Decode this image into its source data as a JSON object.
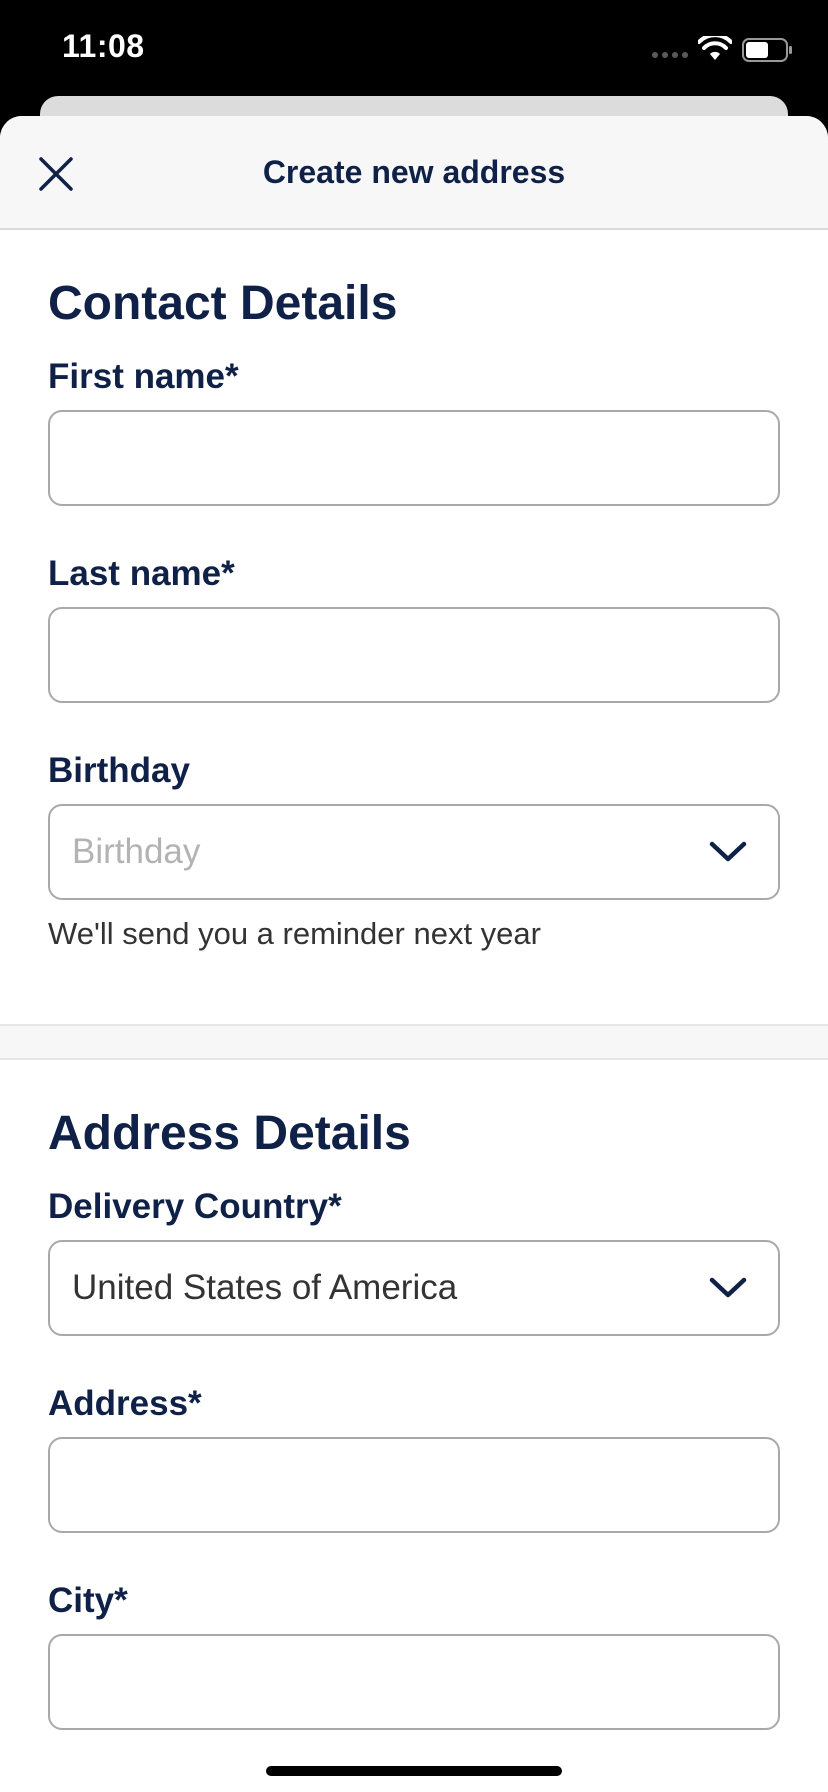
{
  "status_bar": {
    "time": "11:08",
    "icons": [
      "signal-icon",
      "wifi-icon",
      "battery-icon"
    ]
  },
  "header": {
    "title": "Create new address",
    "close_icon": "close-icon"
  },
  "contact_section": {
    "heading": "Contact Details",
    "first_name": {
      "label": "First name*",
      "value": ""
    },
    "last_name": {
      "label": "Last name*",
      "value": ""
    },
    "birthday": {
      "label": "Birthday",
      "placeholder": "Birthday",
      "helper": "We'll send you a reminder next year"
    }
  },
  "address_section": {
    "heading": "Address Details",
    "delivery_country": {
      "label": "Delivery Country*",
      "value": "United States of America"
    },
    "address": {
      "label": "Address*",
      "value": ""
    },
    "city": {
      "label": "City*",
      "value": ""
    }
  },
  "colors": {
    "primary_text": "#0f2147",
    "field_border": "#a9a9a9",
    "placeholder": "#b3b3b3",
    "header_bg": "#f7f7f7"
  }
}
